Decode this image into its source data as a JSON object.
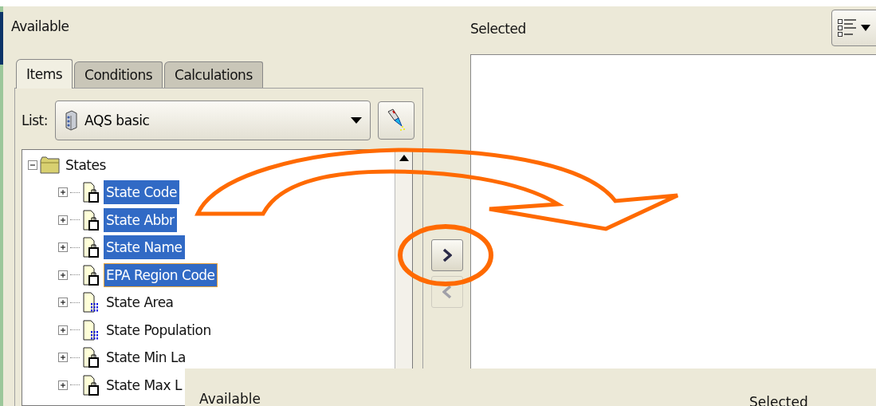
{
  "available_label": "Available",
  "tabs": [
    {
      "label": "Items",
      "selected": true
    },
    {
      "label": "Conditions",
      "selected": false
    },
    {
      "label": "Calculations",
      "selected": false
    }
  ],
  "list": {
    "label": "List:",
    "value": "AQS basic"
  },
  "tree": [
    {
      "label": "States",
      "expanded": true,
      "children": [
        {
          "label": "State Code",
          "kind": "key",
          "selected": true,
          "focused": false,
          "expanded": false
        },
        {
          "label": "State Abbr",
          "kind": "key",
          "selected": true,
          "focused": false,
          "expanded": false
        },
        {
          "label": "State Name",
          "kind": "key",
          "selected": true,
          "focused": false,
          "expanded": false
        },
        {
          "label": "EPA Region Code",
          "kind": "key",
          "selected": true,
          "focused": true,
          "expanded": false
        },
        {
          "label": "State Area",
          "kind": "measure",
          "selected": false,
          "focused": false,
          "expanded": false
        },
        {
          "label": "State Population",
          "kind": "measure",
          "selected": false,
          "focused": false,
          "expanded": false
        },
        {
          "label": "State Min La",
          "kind": "key",
          "selected": false,
          "focused": false,
          "expanded": false
        },
        {
          "label": "State Max L",
          "kind": "key",
          "selected": false,
          "focused": false,
          "expanded": false
        }
      ]
    }
  ],
  "move_buttons": [
    {
      "kind": "right",
      "disabled": false
    },
    {
      "kind": "left",
      "disabled": true
    }
  ],
  "selected_label": "Selected",
  "overlay": {
    "available_label": "Available",
    "selected_label": "Selected"
  }
}
